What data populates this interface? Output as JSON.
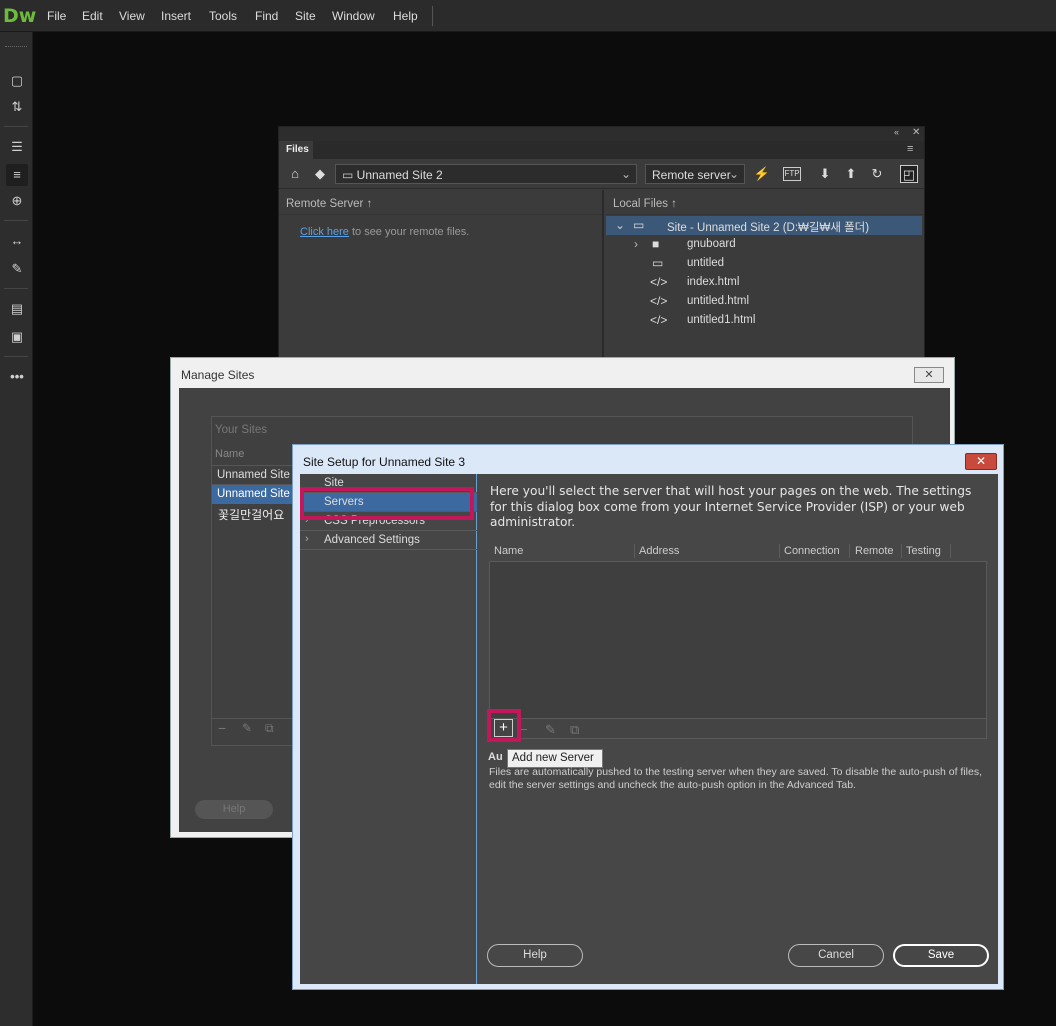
{
  "app": {
    "logo": "Dw"
  },
  "menu": [
    "File",
    "Edit",
    "View",
    "Insert",
    "Tools",
    "Find",
    "Site",
    "Window",
    "Help"
  ],
  "files_panel": {
    "tab": "Files",
    "site_select": "Unnamed Site 2",
    "server_select": "Remote server",
    "remote_header": "Remote Server ↑",
    "remote_link": "Click here",
    "remote_hint": " to see your remote files.",
    "local_header": "Local Files ↑",
    "tree": [
      {
        "label": "Site - Unnamed Site 2 (D:₩길₩새 폴더)",
        "type": "site"
      },
      {
        "label": "gnuboard",
        "type": "folder"
      },
      {
        "label": "untitled",
        "type": "folder"
      },
      {
        "label": "index.html",
        "type": "file"
      },
      {
        "label": "untitled.html",
        "type": "file"
      },
      {
        "label": "untitled1.html",
        "type": "file"
      }
    ]
  },
  "manage_sites": {
    "title": "Manage Sites",
    "close": "✕",
    "your_sites_label": "Your Sites",
    "name_header": "Name",
    "sites": [
      "Unnamed Site",
      "Unnamed Site",
      "꽃길만걸어요"
    ],
    "help": "Help"
  },
  "site_setup": {
    "title": "Site Setup for Unnamed Site 3",
    "close": "✕",
    "sidebar": [
      "Site",
      "Servers",
      "CSS Preprocessors",
      "Advanced Settings"
    ],
    "description": "Here you'll select the server that will host your pages on the web. The settings for this dialog box come from your Internet Service Provider (ISP) or your web administrator.",
    "columns": [
      "Name",
      "Address",
      "Connection",
      "Remote",
      "Testing"
    ],
    "tooltip": "Add new Server",
    "autopush_label": "Au",
    "autopush_text": "Files are automatically pushed to the testing server when they are saved. To disable the auto-push of files, edit the server settings and uncheck the auto-push option in the Advanced Tab.",
    "help": "Help",
    "cancel": "Cancel",
    "save": "Save"
  },
  "colors": {
    "accent": "#6cbb3c",
    "highlight": "#c2185b",
    "selection": "#3c6aa0"
  }
}
